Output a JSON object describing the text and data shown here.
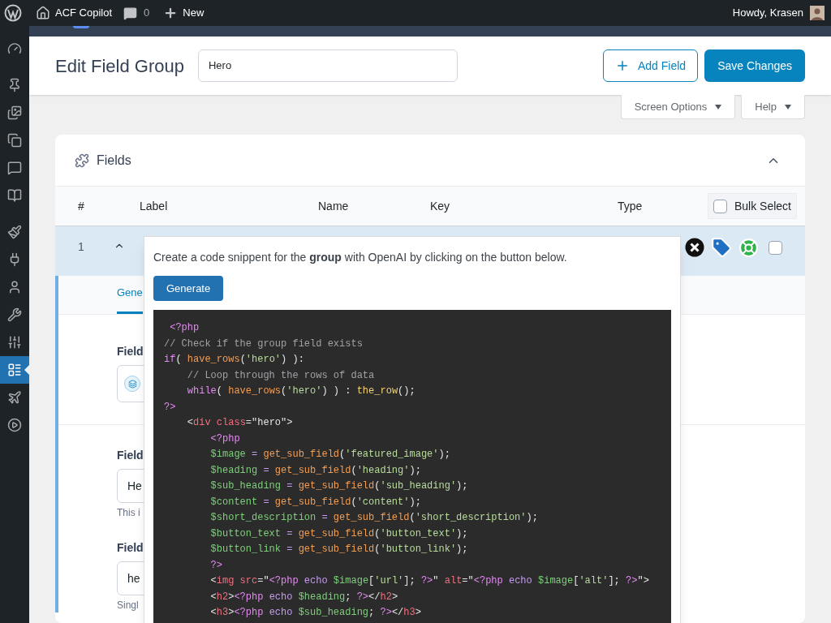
{
  "admin_bar": {
    "site": "ACF Copilot",
    "comments": "0",
    "new": "New",
    "greeting": "Howdy, Krasen"
  },
  "sidebar": {
    "groups": [
      {
        "items": [
          {
            "selected": false
          }
        ]
      },
      {
        "items": [
          {
            "selected": false
          },
          {
            "selected": false
          },
          {
            "selected": false
          },
          {
            "selected": false
          },
          {
            "selected": false
          }
        ]
      },
      {
        "items": [
          {
            "selected": false
          },
          {
            "selected": false
          },
          {
            "selected": false
          },
          {
            "selected": false
          },
          {
            "selected": false
          },
          {
            "selected": true
          },
          {
            "selected": false
          },
          {
            "selected": false
          }
        ]
      }
    ]
  },
  "header": {
    "title": "Edit Field Group",
    "group_name": "Hero",
    "add_button": "Add Field",
    "save_button": "Save Changes"
  },
  "screen_tabs": [
    "Screen Options",
    "Help"
  ],
  "fields_panel": {
    "title": "Fields",
    "expanded": true,
    "columns": [
      "#",
      "Label",
      "Name",
      "Key",
      "Type"
    ],
    "bulk_select": {
      "label": "Bulk Select",
      "checked": false
    },
    "rows": [
      {
        "number": "1",
        "expanded": true,
        "checked": false
      }
    ],
    "tabs": [
      {
        "label": "Gene",
        "selected": true
      }
    ],
    "settings": [
      {
        "label": "Field",
        "has_icon": true
      },
      {
        "label": "Field",
        "value": "He",
        "has_icon": false,
        "help": "This i"
      },
      {
        "label": "Field",
        "value": "he",
        "has_icon": false,
        "help": "Singl"
      }
    ]
  },
  "popover": {
    "intro": "Create a code snippent for the **group** with OpenAI by clicking on the button below.",
    "button": "Generate",
    "code": [
      [
        {
          "t": " <?php",
          "kind": "kw"
        }
      ],
      [
        {
          "t": "// Check if the group field exists",
          "kind": "comment"
        }
      ],
      [
        {
          "t": "if",
          "kind": "kw"
        },
        {
          "t": "( ",
          "kind": "plain"
        },
        {
          "t": "have_rows",
          "kind": "fn"
        },
        {
          "t": "(",
          "kind": "plain"
        },
        {
          "t": "'hero'",
          "kind": "str"
        },
        {
          "t": ") ):",
          "kind": "plain"
        }
      ],
      [
        {
          "t": "    // Loop through the rows of data",
          "kind": "comment"
        }
      ],
      [
        {
          "t": "    while",
          "kind": "kw"
        },
        {
          "t": "( ",
          "kind": "plain"
        },
        {
          "t": "have_rows",
          "kind": "fn"
        },
        {
          "t": "(",
          "kind": "plain"
        },
        {
          "t": "'hero'",
          "kind": "str"
        },
        {
          "t": ") ) : ",
          "kind": "plain"
        },
        {
          "t": "the_row",
          "kind": "yfn"
        },
        {
          "t": "();",
          "kind": "plain"
        }
      ],
      [
        {
          "t": "?>",
          "kind": "kw"
        }
      ],
      [
        {
          "t": "    <",
          "kind": "plain"
        },
        {
          "t": "div",
          "kind": "tag"
        },
        {
          "t": " class",
          "kind": "attr"
        },
        {
          "t": "=\"hero\">",
          "kind": "plain"
        }
      ],
      [
        {
          "t": "        <?php",
          "kind": "kw"
        }
      ],
      [
        {
          "t": "        $image",
          "kind": "var"
        },
        {
          "t": " = ",
          "kind": "op"
        },
        {
          "t": "get_sub_field",
          "kind": "fn"
        },
        {
          "t": "(",
          "kind": "plain"
        },
        {
          "t": "'featured_image'",
          "kind": "str"
        },
        {
          "t": ");",
          "kind": "plain"
        }
      ],
      [
        {
          "t": "        $heading",
          "kind": "var"
        },
        {
          "t": " = ",
          "kind": "op"
        },
        {
          "t": "get_sub_field",
          "kind": "fn"
        },
        {
          "t": "(",
          "kind": "plain"
        },
        {
          "t": "'heading'",
          "kind": "str"
        },
        {
          "t": ");",
          "kind": "plain"
        }
      ],
      [
        {
          "t": "        $sub_heading",
          "kind": "var"
        },
        {
          "t": " = ",
          "kind": "op"
        },
        {
          "t": "get_sub_field",
          "kind": "fn"
        },
        {
          "t": "(",
          "kind": "plain"
        },
        {
          "t": "'sub_heading'",
          "kind": "str"
        },
        {
          "t": ");",
          "kind": "plain"
        }
      ],
      [
        {
          "t": "        $content",
          "kind": "var"
        },
        {
          "t": " = ",
          "kind": "op"
        },
        {
          "t": "get_sub_field",
          "kind": "fn"
        },
        {
          "t": "(",
          "kind": "plain"
        },
        {
          "t": "'content'",
          "kind": "str"
        },
        {
          "t": ");",
          "kind": "plain"
        }
      ],
      [
        {
          "t": "        $short_description",
          "kind": "var"
        },
        {
          "t": " = ",
          "kind": "op"
        },
        {
          "t": "get_sub_field",
          "kind": "fn"
        },
        {
          "t": "(",
          "kind": "plain"
        },
        {
          "t": "'short_description'",
          "kind": "str"
        },
        {
          "t": ");",
          "kind": "plain"
        }
      ],
      [
        {
          "t": "        $button_text",
          "kind": "var"
        },
        {
          "t": " = ",
          "kind": "op"
        },
        {
          "t": "get_sub_field",
          "kind": "fn"
        },
        {
          "t": "(",
          "kind": "plain"
        },
        {
          "t": "'button_text'",
          "kind": "str"
        },
        {
          "t": ");",
          "kind": "plain"
        }
      ],
      [
        {
          "t": "        $button_link",
          "kind": "var"
        },
        {
          "t": " = ",
          "kind": "op"
        },
        {
          "t": "get_sub_field",
          "kind": "fn"
        },
        {
          "t": "(",
          "kind": "plain"
        },
        {
          "t": "'button_link'",
          "kind": "str"
        },
        {
          "t": ");",
          "kind": "plain"
        }
      ],
      [
        {
          "t": "        ?>",
          "kind": "kw"
        }
      ],
      [
        {
          "t": "        <",
          "kind": "plain"
        },
        {
          "t": "img",
          "kind": "tag"
        },
        {
          "t": " src",
          "kind": "attr"
        },
        {
          "t": "=\"",
          "kind": "plain"
        },
        {
          "t": "<?php",
          "kind": "kw"
        },
        {
          "t": " echo",
          "kind": "op"
        },
        {
          "t": " $image",
          "kind": "var"
        },
        {
          "t": "[",
          "kind": "plain"
        },
        {
          "t": "'url'",
          "kind": "str"
        },
        {
          "t": "]; ",
          "kind": "plain"
        },
        {
          "t": "?>",
          "kind": "kw"
        },
        {
          "t": "\" ",
          "kind": "plain"
        },
        {
          "t": "alt",
          "kind": "attr"
        },
        {
          "t": "=\"",
          "kind": "plain"
        },
        {
          "t": "<?php",
          "kind": "kw"
        },
        {
          "t": " echo",
          "kind": "op"
        },
        {
          "t": " $image",
          "kind": "var"
        },
        {
          "t": "[",
          "kind": "plain"
        },
        {
          "t": "'alt'",
          "kind": "str"
        },
        {
          "t": "]; ",
          "kind": "plain"
        },
        {
          "t": "?>",
          "kind": "kw"
        },
        {
          "t": "\">",
          "kind": "plain"
        }
      ],
      [
        {
          "t": "        <",
          "kind": "plain"
        },
        {
          "t": "h2",
          "kind": "tag"
        },
        {
          "t": ">",
          "kind": "plain"
        },
        {
          "t": "<?php",
          "kind": "kw"
        },
        {
          "t": " echo",
          "kind": "op"
        },
        {
          "t": " $heading",
          "kind": "var"
        },
        {
          "t": "; ",
          "kind": "plain"
        },
        {
          "t": "?>",
          "kind": "kw"
        },
        {
          "t": "</",
          "kind": "plain"
        },
        {
          "t": "h2",
          "kind": "tag"
        },
        {
          "t": ">",
          "kind": "plain"
        }
      ],
      [
        {
          "t": "        <",
          "kind": "plain"
        },
        {
          "t": "h3",
          "kind": "tag"
        },
        {
          "t": ">",
          "kind": "plain"
        },
        {
          "t": "<?php",
          "kind": "kw"
        },
        {
          "t": " echo",
          "kind": "op"
        },
        {
          "t": " $sub_heading",
          "kind": "var"
        },
        {
          "t": "; ",
          "kind": "plain"
        },
        {
          "t": "?>",
          "kind": "kw"
        },
        {
          "t": "</",
          "kind": "plain"
        },
        {
          "t": "h3",
          "kind": "tag"
        },
        {
          "t": ">",
          "kind": "plain"
        }
      ]
    ]
  }
}
